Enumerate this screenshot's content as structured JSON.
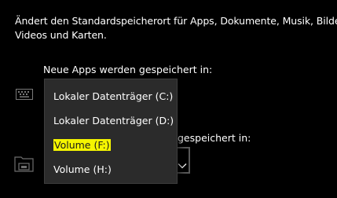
{
  "description_lines": [
    "Ändert den Standardspeicherort für Apps, Dokumente, Musik, Bilder,",
    "Videos und Karten."
  ],
  "new_apps": {
    "label": "Neue Apps werden gespeichert in:",
    "icon": "keyboard-icon"
  },
  "second_section": {
    "label_partial": "gespeichert in:",
    "icon": "folder-icon",
    "combo_icon": "chevron-down-icon"
  },
  "dropdown": {
    "options": [
      "Lokaler Datenträger (C:)",
      "Lokaler Datenträger (D:)",
      "Volume (F:)",
      "Volume (H:)"
    ],
    "highlighted_index": 2,
    "highlight_color": "#f5f500"
  }
}
